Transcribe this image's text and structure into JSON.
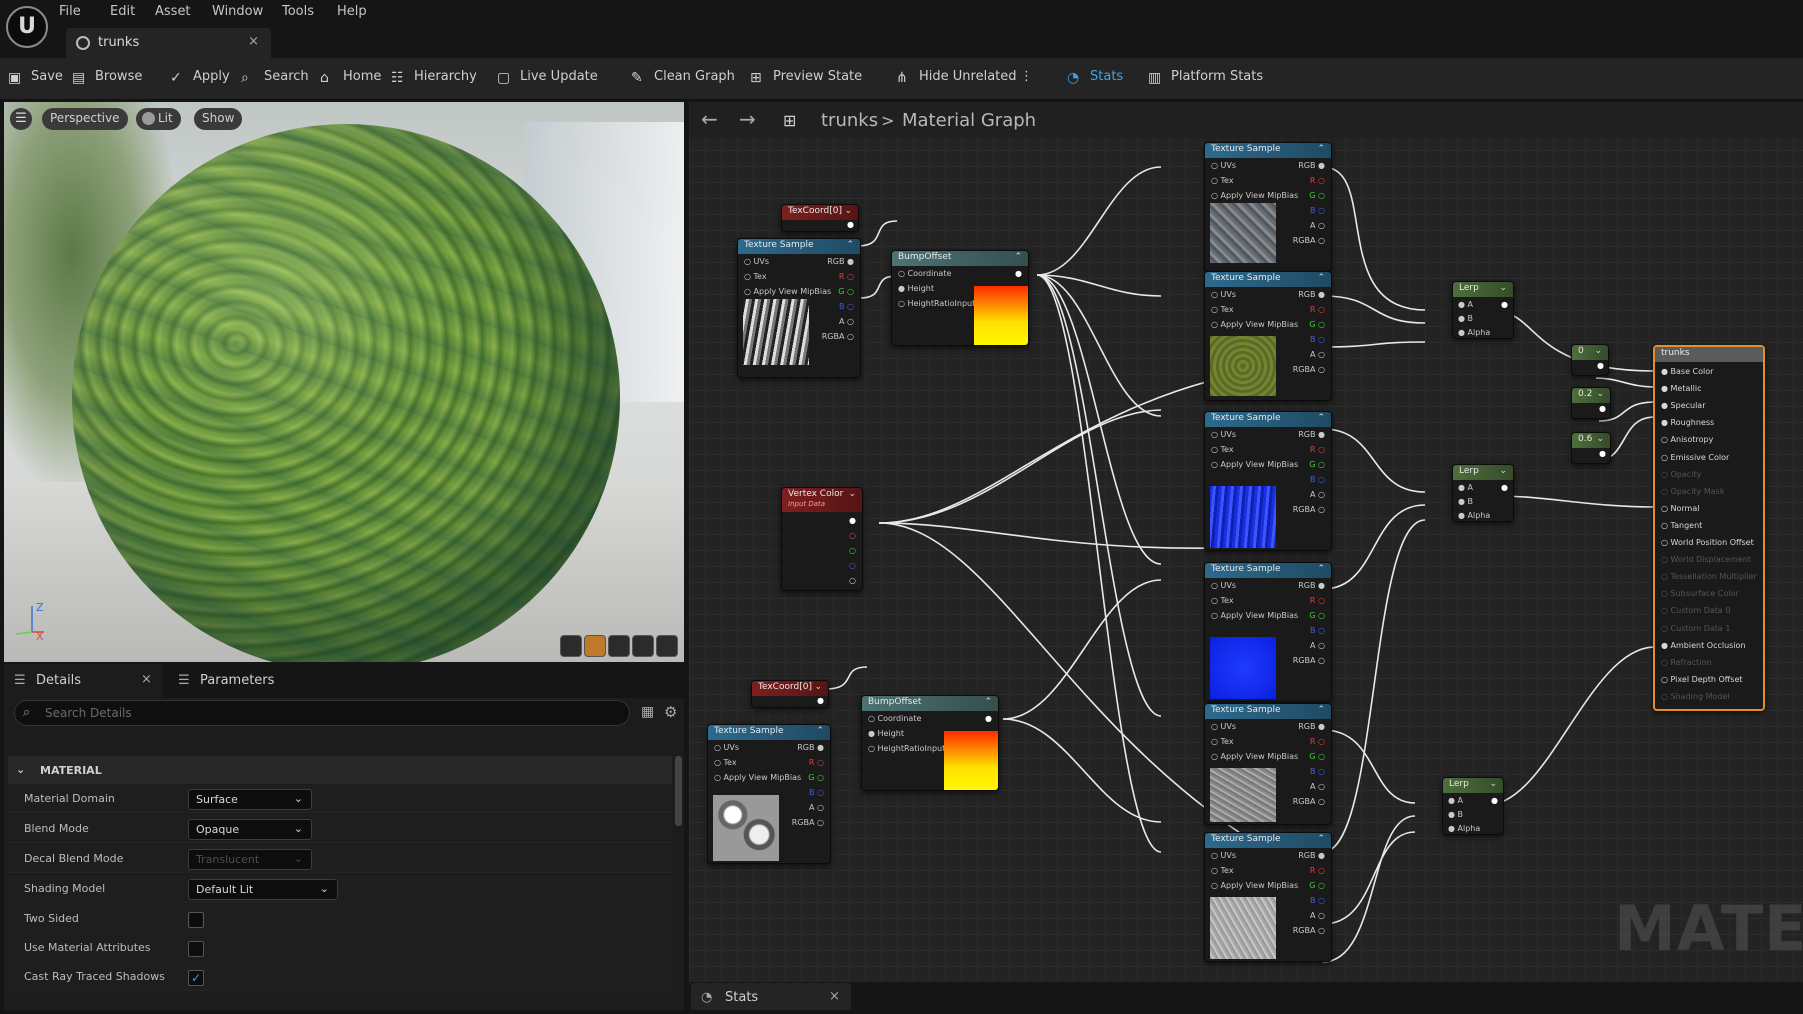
{
  "menubar": {
    "logo": "U",
    "items": [
      "File",
      "Edit",
      "Asset",
      "Window",
      "Tools",
      "Help"
    ]
  },
  "document_tab": {
    "title": "trunks",
    "close": "×"
  },
  "toolbar": {
    "items": [
      "Save",
      "Browse",
      "Apply",
      "Search",
      "Home",
      "Hierarchy",
      "Live Update",
      "Clean Graph",
      "Preview State",
      "Hide Unrelated",
      "Stats",
      "Platform Stats"
    ],
    "more": "⋮"
  },
  "viewport": {
    "perspective": "Perspective",
    "lit": "Lit",
    "show": "Show",
    "axis_z": "Z",
    "axis_x": "X"
  },
  "details": {
    "tab_details": "Details",
    "tab_parameters": "Parameters",
    "close": "×",
    "search_placeholder": "Search Details",
    "section": "MATERIAL",
    "props": [
      {
        "label": "Material Domain",
        "value": "Surface"
      },
      {
        "label": "Blend Mode",
        "value": "Opaque"
      },
      {
        "label": "Decal Blend Mode",
        "value": "Translucent"
      },
      {
        "label": "Shading Model",
        "value": "Default Lit"
      },
      {
        "label": "Two Sided",
        "value": ""
      },
      {
        "label": "Use Material Attributes",
        "value": ""
      },
      {
        "label": "Cast Ray Traced Shadows",
        "value": "✓"
      }
    ]
  },
  "graph": {
    "breadcrumb_root": "trunks",
    "breadcrumb_sep": ">",
    "breadcrumb_leaf": "Material Graph",
    "back": "←",
    "forward": "→",
    "watermark": "MATERI",
    "texture_sample": {
      "title": "Texture Sample",
      "uvs": "UVs",
      "tex": "Tex",
      "mip": "Apply View MipBias",
      "rgb": "RGB",
      "r": "R",
      "g": "G",
      "b": "B",
      "a": "A",
      "rgba": "RGBA"
    },
    "texcoord": "TexCoord[0]",
    "bumpoffset": {
      "title": "BumpOffset",
      "coordinate": "Coordinate",
      "height": "Height",
      "ratio": "HeightRatioInput"
    },
    "vertex_color": {
      "title": "Vertex Color",
      "subtitle": "Input Data"
    },
    "lerp": {
      "title": "Lerp",
      "a": "A",
      "b": "B",
      "alpha": "Alpha"
    },
    "constants": [
      "0",
      "0.2",
      "0.6"
    ],
    "result": {
      "title": "trunks",
      "inputs": [
        "Base Color",
        "Metallic",
        "Specular",
        "Roughness",
        "Anisotropy",
        "Emissive Color",
        "Opacity",
        "Opacity Mask",
        "Normal",
        "Tangent",
        "World Position Offset",
        "World Displacement",
        "Tessellation Multiplier",
        "Subsurface Color",
        "Custom Data 0",
        "Custom Data 1",
        "Ambient Occlusion",
        "Refraction",
        "Pixel Depth Offset",
        "Shading Model"
      ]
    }
  },
  "stats_tab": {
    "title": "Stats",
    "close": "×"
  },
  "colors": {
    "accent": "#3fa1e8",
    "result_border": "#e0902a",
    "header_blue": "#2d6a8e",
    "header_red": "#7f1f1f"
  }
}
